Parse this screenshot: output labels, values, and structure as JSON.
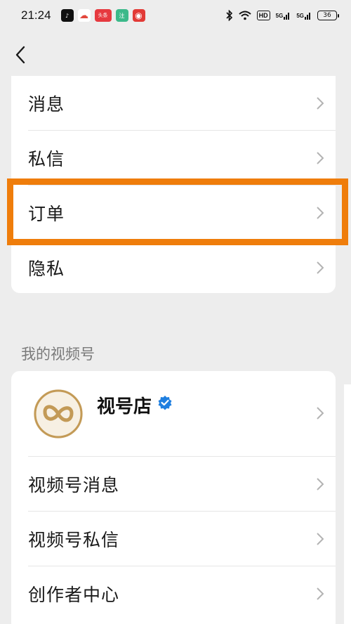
{
  "status_bar": {
    "time": "21:24",
    "app_icons": [
      {
        "name": "tiktok-icon",
        "bg": "#111111",
        "glyph": "♪"
      },
      {
        "name": "cloud-app-icon",
        "bg": "#ffffff",
        "glyph": "☁"
      },
      {
        "name": "toutiao-icon",
        "bg": "#e6393f",
        "glyph": "头条"
      },
      {
        "name": "green-app-icon",
        "bg": "#3cb98a",
        "glyph": "注"
      },
      {
        "name": "netease-music-icon",
        "bg": "#e23a36",
        "glyph": "◉"
      }
    ],
    "network_a": "5G",
    "network_b": "5G",
    "hd": "HD",
    "battery": "36"
  },
  "menu_top": {
    "items": [
      {
        "label": "消息"
      },
      {
        "label": "私信"
      },
      {
        "label": "订单"
      },
      {
        "label": "隐私"
      }
    ]
  },
  "section": {
    "title": "我的视频号"
  },
  "channel_card": {
    "shop_name": "视号店",
    "items": [
      {
        "label": "视频号消息"
      },
      {
        "label": "视频号私信"
      },
      {
        "label": "创作者中心"
      }
    ]
  },
  "colors": {
    "highlight": "#ef7d0b",
    "verified": "#1f7fe0",
    "logo_gold": "#c39a56"
  }
}
